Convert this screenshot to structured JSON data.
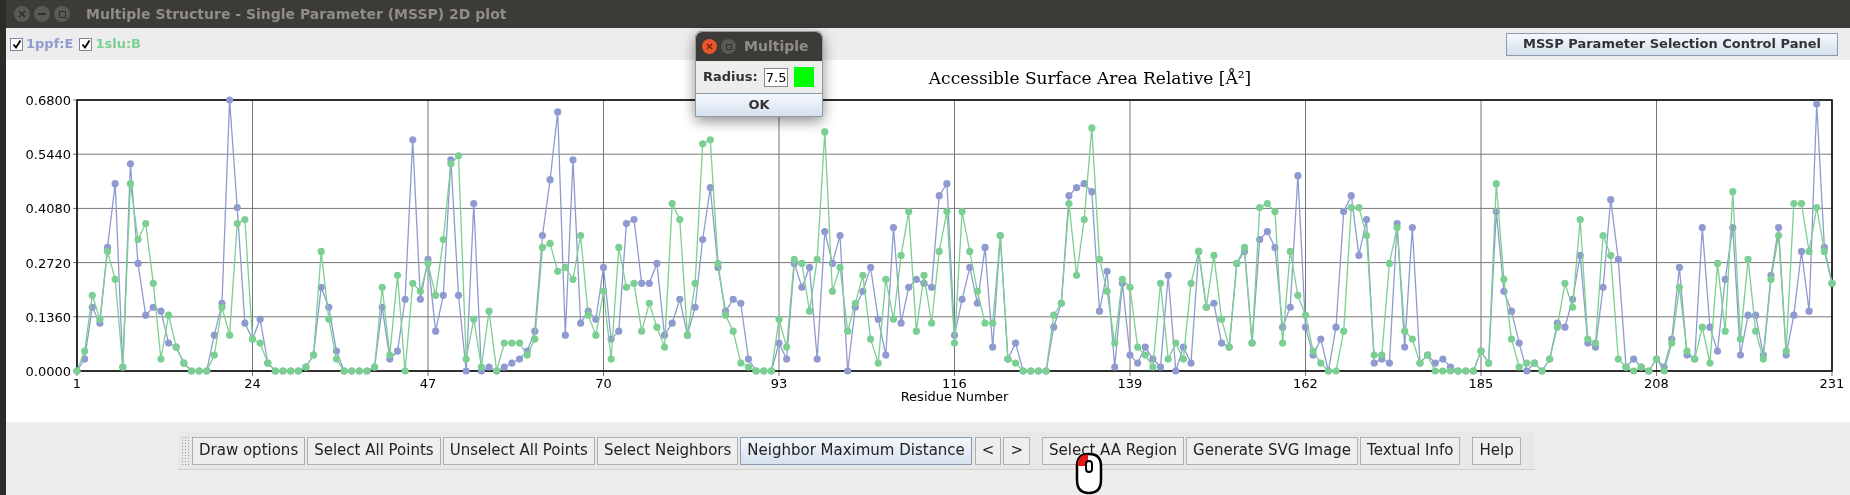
{
  "window": {
    "title": "Multiple Structure - Single Parameter (MSSP) 2D plot"
  },
  "legend_checkboxes": [
    {
      "checked": true
    },
    {
      "checked": true
    }
  ],
  "control_panel_button": "MSSP Parameter Selection Control Panel",
  "chart": {
    "chart_data": {
      "type": "line",
      "title": "Accessible Surface Area Relative [Å²]",
      "xlabel": "Residue Number",
      "grid": true,
      "x": [
        1,
        2,
        3,
        4,
        5,
        6,
        7,
        8,
        9,
        10,
        11,
        12,
        13,
        14,
        15,
        16,
        17,
        18,
        19,
        20,
        21,
        22,
        23,
        24,
        25,
        26,
        27,
        28,
        29,
        30,
        31,
        32,
        33,
        34,
        35,
        36,
        37,
        38,
        39,
        40,
        41,
        42,
        43,
        44,
        45,
        46,
        47,
        48,
        49,
        50,
        51,
        52,
        53,
        54,
        55,
        56,
        57,
        58,
        59,
        60,
        61,
        62,
        63,
        64,
        65,
        66,
        67,
        68,
        69,
        70,
        71,
        72,
        73,
        74,
        75,
        76,
        77,
        78,
        79,
        80,
        81,
        82,
        83,
        84,
        85,
        86,
        87,
        88,
        89,
        90,
        91,
        92,
        93,
        94,
        95,
        96,
        97,
        98,
        99,
        100,
        101,
        102,
        103,
        104,
        105,
        106,
        107,
        108,
        109,
        110,
        111,
        112,
        113,
        114,
        115,
        116,
        117,
        118,
        119,
        120,
        121,
        122,
        123,
        124,
        125,
        126,
        127,
        128,
        129,
        130,
        131,
        132,
        133,
        134,
        135,
        136,
        137,
        138,
        139,
        140,
        141,
        142,
        143,
        144,
        145,
        146,
        147,
        148,
        149,
        150,
        151,
        152,
        153,
        154,
        155,
        156,
        157,
        158,
        159,
        160,
        161,
        162,
        163,
        164,
        165,
        166,
        167,
        168,
        169,
        170,
        171,
        172,
        173,
        174,
        175,
        176,
        177,
        178,
        179,
        180,
        181,
        182,
        183,
        184,
        185,
        186,
        187,
        188,
        189,
        190,
        191,
        192,
        193,
        194,
        195,
        196,
        197,
        198,
        199,
        200,
        201,
        202,
        203,
        204,
        205,
        206,
        207,
        208,
        209,
        210,
        211,
        212,
        213,
        214,
        215,
        216,
        217,
        218,
        219,
        220,
        221,
        222,
        223,
        224,
        225,
        226,
        227,
        228,
        229,
        230,
        231
      ],
      "xlim": [
        1,
        231
      ],
      "ylim": [
        0,
        0.68
      ],
      "xticks": [
        1,
        24,
        47,
        70,
        93,
        116,
        139,
        162,
        185,
        208,
        231
      ],
      "yticks": [
        {
          "value": 0,
          "label": "0.0000"
        },
        {
          "value": 0.136,
          "label": "0.1360"
        },
        {
          "value": 0.272,
          "label": "0.2720"
        },
        {
          "value": 0.408,
          "label": "0.4080"
        },
        {
          "value": 0.544,
          "label": "0.5440"
        },
        {
          "value": 0.68,
          "label": "0.6800"
        }
      ],
      "series": [
        {
          "name": "1ppf:E",
          "color": "#8f9bd0",
          "marker": "circle",
          "values": [
            0,
            0.03,
            0.16,
            0.12,
            0.31,
            0.47,
            0.01,
            0.52,
            0.27,
            0.14,
            0.16,
            0.15,
            0.07,
            0.06,
            0.02,
            0,
            0,
            0,
            0.09,
            0.17,
            0.68,
            0.41,
            0.12,
            0.08,
            0.13,
            0.02,
            0,
            0,
            0,
            0,
            0.01,
            0.04,
            0.21,
            0.16,
            0.05,
            0,
            0,
            0,
            0,
            0.01,
            0.16,
            0.03,
            0.05,
            0.18,
            0.58,
            0.18,
            0.28,
            0.1,
            0.19,
            0.53,
            0.19,
            0,
            0.42,
            0,
            0.01,
            0,
            0.01,
            0.02,
            0.03,
            0.05,
            0.1,
            0.34,
            0.48,
            0.65,
            0.09,
            0.53,
            0.12,
            0.15,
            0.13,
            0.26,
            0.08,
            0.1,
            0.37,
            0.38,
            0.22,
            0.22,
            0.27,
            0.09,
            0.12,
            0.18,
            0.09,
            0.16,
            0.33,
            0.46,
            0.26,
            0.15,
            0.18,
            0.17,
            0.03,
            0,
            0,
            0,
            0.07,
            0.03,
            0.27,
            0.21,
            0.26,
            0.03,
            0.35,
            0.27,
            0.34,
            0,
            0.16,
            0.2,
            0.26,
            0.13,
            0.04,
            0.36,
            0.12,
            0.21,
            0.23,
            0.22,
            0.21,
            0.44,
            0.47,
            0.09,
            0.18,
            0.26,
            0.17,
            0.31,
            0.06,
            0.34,
            0.03,
            0.07,
            0,
            0,
            0,
            0,
            0.11,
            0.17,
            0.44,
            0.46,
            0.47,
            0.45,
            0.15,
            0.25,
            0.01,
            0.22,
            0.04,
            0.02,
            0.06,
            0.03,
            0.01,
            0.24,
            0,
            0.06,
            0.02,
            0.3,
            0.16,
            0.17,
            0.07,
            0.06,
            0.27,
            0.3,
            0.07,
            0.33,
            0.35,
            0.31,
            0.11,
            0.16,
            0.49,
            0.11,
            0.04,
            0.08,
            0,
            0.11,
            0.4,
            0.44,
            0.29,
            0.38,
            0.02,
            0.03,
            0.02,
            0.37,
            0.06,
            0.36,
            0.02,
            0.04,
            0.02,
            0.03,
            0.01,
            0,
            0,
            0,
            0.05,
            0.02,
            0.4,
            0.2,
            0.15,
            0.07,
            0,
            0.02,
            0,
            0.03,
            0.12,
            0.11,
            0.18,
            0.29,
            0.07,
            0.06,
            0.21,
            0.43,
            0.28,
            0.01,
            0.03,
            0.01,
            0,
            0.03,
            0.01,
            0.08,
            0.26,
            0.04,
            0.03,
            0.36,
            0.11,
            0.05,
            0.23,
            0.36,
            0.04,
            0.14,
            0.14,
            0.04,
            0.24,
            0.36,
            0.04,
            0.14,
            0.3,
            0.15,
            0.67,
            0.31,
            0.22
          ]
        },
        {
          "name": "1slu:B",
          "color": "#7ccf92",
          "marker": "circle",
          "values": [
            0,
            0.05,
            0.19,
            0.13,
            0.3,
            0.23,
            0.01,
            0.47,
            0.33,
            0.37,
            0.22,
            0.03,
            0.14,
            0.06,
            0.02,
            0,
            0,
            0,
            0.04,
            0.16,
            0.09,
            0.37,
            0.38,
            0.08,
            0.07,
            0.02,
            0,
            0,
            0,
            0,
            0.01,
            0.04,
            0.3,
            0.13,
            0.03,
            0,
            0,
            0,
            0,
            0.01,
            0.21,
            0.04,
            0.24,
            0,
            0.22,
            0.2,
            0.27,
            0.19,
            0.33,
            0.52,
            0.54,
            0.03,
            0.13,
            0.01,
            0.15,
            0,
            0.07,
            0.07,
            0.07,
            0.04,
            0.08,
            0.31,
            0.32,
            0.25,
            0.26,
            0.23,
            0.34,
            0.14,
            0.09,
            0.2,
            0.03,
            0.31,
            0.21,
            0.22,
            0.1,
            0.17,
            0.11,
            0.06,
            0.42,
            0.38,
            0.09,
            0.22,
            0.57,
            0.58,
            0.27,
            0.14,
            0.1,
            0.02,
            0.01,
            0,
            0,
            0,
            0.13,
            0.06,
            0.28,
            0.27,
            0.15,
            0.28,
            0.6,
            0.2,
            0.26,
            0.1,
            0.17,
            0.24,
            0.08,
            0.02,
            0.23,
            0.13,
            0.29,
            0.4,
            0.1,
            0.24,
            0.12,
            0.3,
            0.4,
            0.07,
            0.4,
            0.3,
            0.2,
            0.12,
            0.12,
            0.34,
            0.03,
            0.02,
            0,
            0,
            0,
            0,
            0.14,
            0.17,
            0.42,
            0.24,
            0.38,
            0.61,
            0.28,
            0.2,
            0.07,
            0.23,
            0.21,
            0.06,
            0.04,
            0.01,
            0.22,
            0.03,
            0.07,
            0.03,
            0.22,
            0.3,
            0.16,
            0.29,
            0.13,
            0.06,
            0.27,
            0.31,
            0.07,
            0.41,
            0.42,
            0.4,
            0.07,
            0.3,
            0.19,
            0.14,
            0.05,
            0.02,
            0,
            0,
            0.1,
            0.41,
            0.41,
            0.34,
            0.04,
            0.04,
            0.27,
            0.36,
            0.1,
            0.08,
            0.02,
            0.04,
            0,
            0,
            0,
            0,
            0,
            0,
            0.05,
            0.02,
            0.47,
            0.23,
            0.08,
            0.01,
            0.02,
            0.02,
            0,
            0.03,
            0.11,
            0.22,
            0.16,
            0.38,
            0.08,
            0.07,
            0.34,
            0.29,
            0.03,
            0.01,
            0,
            0.01,
            0,
            0.03,
            0,
            0.07,
            0.21,
            0.05,
            0.03,
            0.11,
            0.02,
            0.27,
            0.1,
            0.45,
            0.08,
            0.28,
            0.1,
            0.03,
            0.23,
            0.34,
            0.05,
            0.42,
            0.42,
            0.3,
            0.41,
            0.3,
            0.22
          ]
        }
      ]
    }
  },
  "dialog": {
    "title": "Multiple",
    "label": "Radius:",
    "value": "7.5",
    "color": "#00ff00",
    "button": "OK"
  },
  "toolbar": {
    "groups": [
      [
        {
          "label": "Draw options",
          "highlighted": false
        },
        {
          "label": "Select All Points",
          "highlighted": false
        },
        {
          "label": "Unselect All Points",
          "highlighted": false
        },
        {
          "label": "Select Neighbors",
          "highlighted": false
        },
        {
          "label": "Neighbor Maximum Distance",
          "highlighted": true
        }
      ],
      [
        {
          "label": "<",
          "highlighted": false
        },
        {
          "label": ">",
          "highlighted": false
        }
      ],
      [
        {
          "label": "Select AA Region",
          "highlighted": false
        },
        {
          "label": "Generate SVG Image",
          "highlighted": false
        },
        {
          "label": "Textual Info",
          "highlighted": false
        }
      ],
      [
        {
          "label": "Help",
          "highlighted": false
        }
      ]
    ]
  }
}
